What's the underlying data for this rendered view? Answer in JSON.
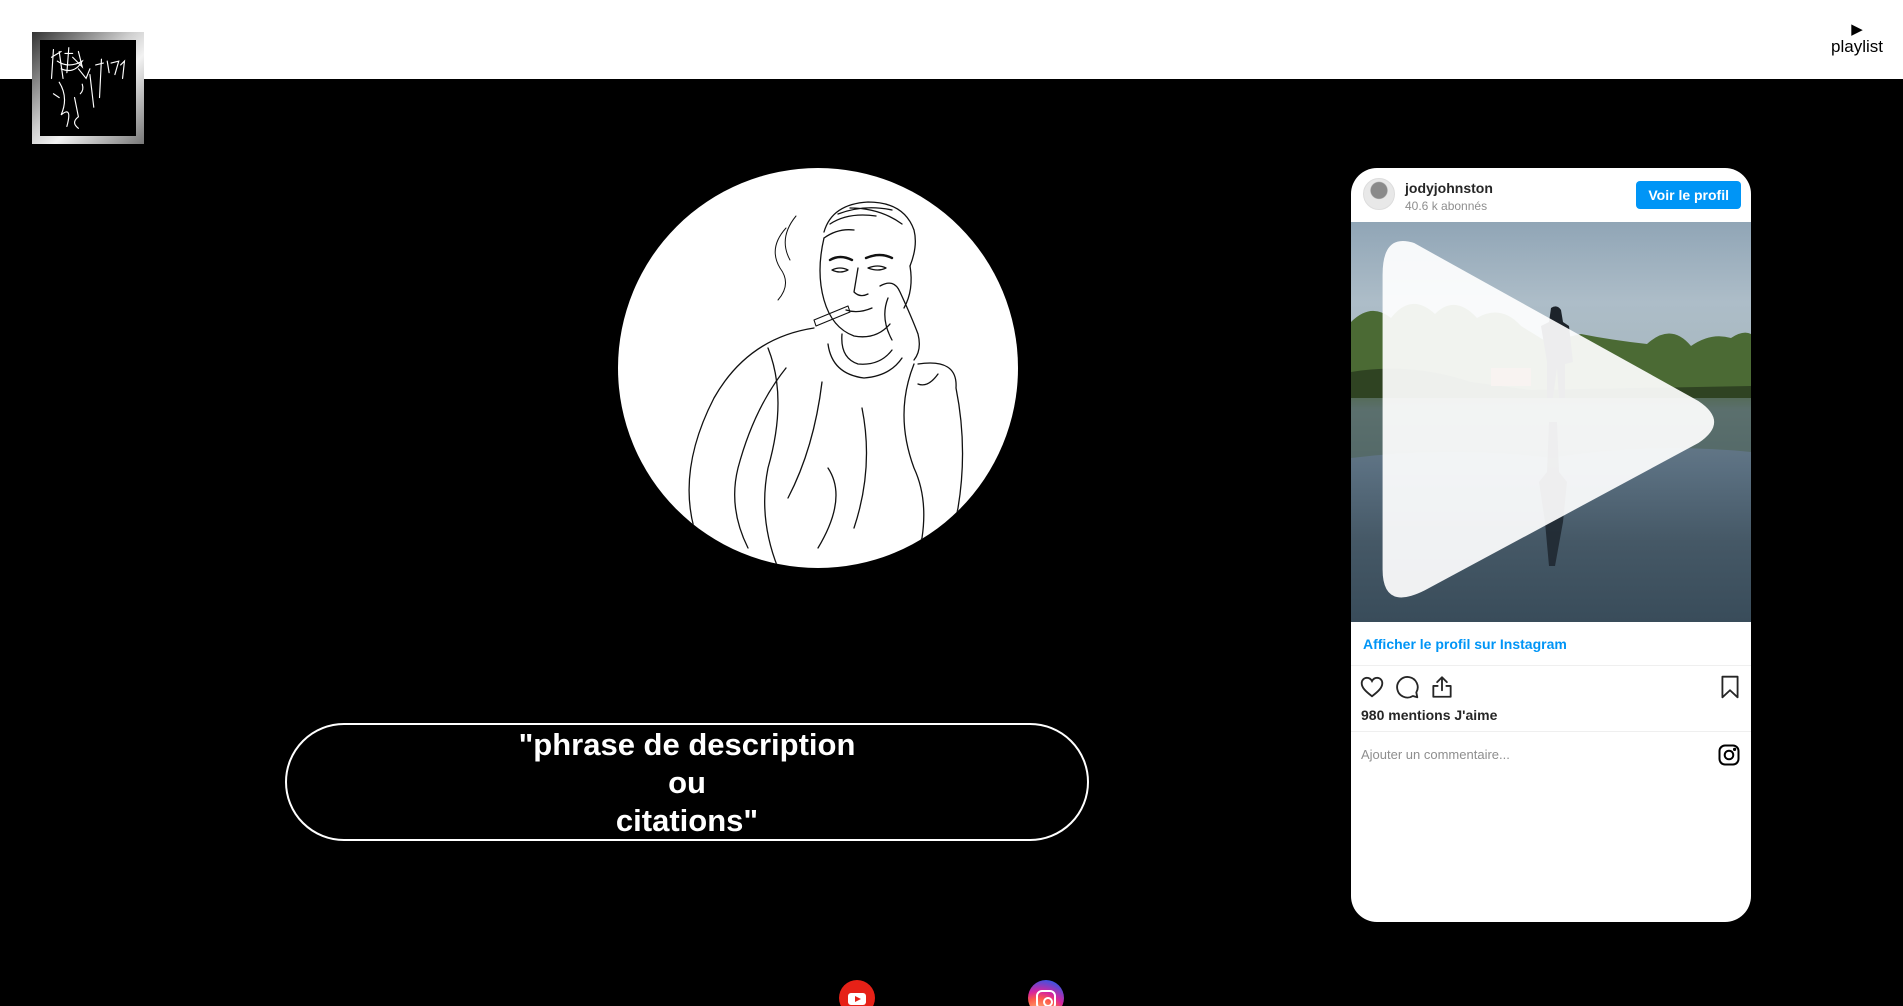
{
  "header": {
    "logo_icon": "sketch-logo-icon",
    "playlist_label": "playlist",
    "playlist_icon": "play-triangle-icon"
  },
  "main": {
    "portrait_icon": "line-art-portrait",
    "quote_lines": [
      "\"phrase de description",
      "ou",
      "citations\""
    ]
  },
  "social": [
    {
      "name": "youtube",
      "icon": "youtube-icon",
      "color": "#e62117"
    },
    {
      "name": "instagram",
      "icon": "instagram-icon",
      "color": "#d6249f"
    }
  ],
  "instagram_embed": {
    "username": "jodyjohnston",
    "followers": "40.6 k abonnés",
    "view_profile_button": "Voir le profil",
    "profile_link": "Afficher le profil sur Instagram",
    "likes": "980 mentions J'aime",
    "comment_placeholder": "Ajouter un commentaire...",
    "accent_color": "#0095f6"
  }
}
